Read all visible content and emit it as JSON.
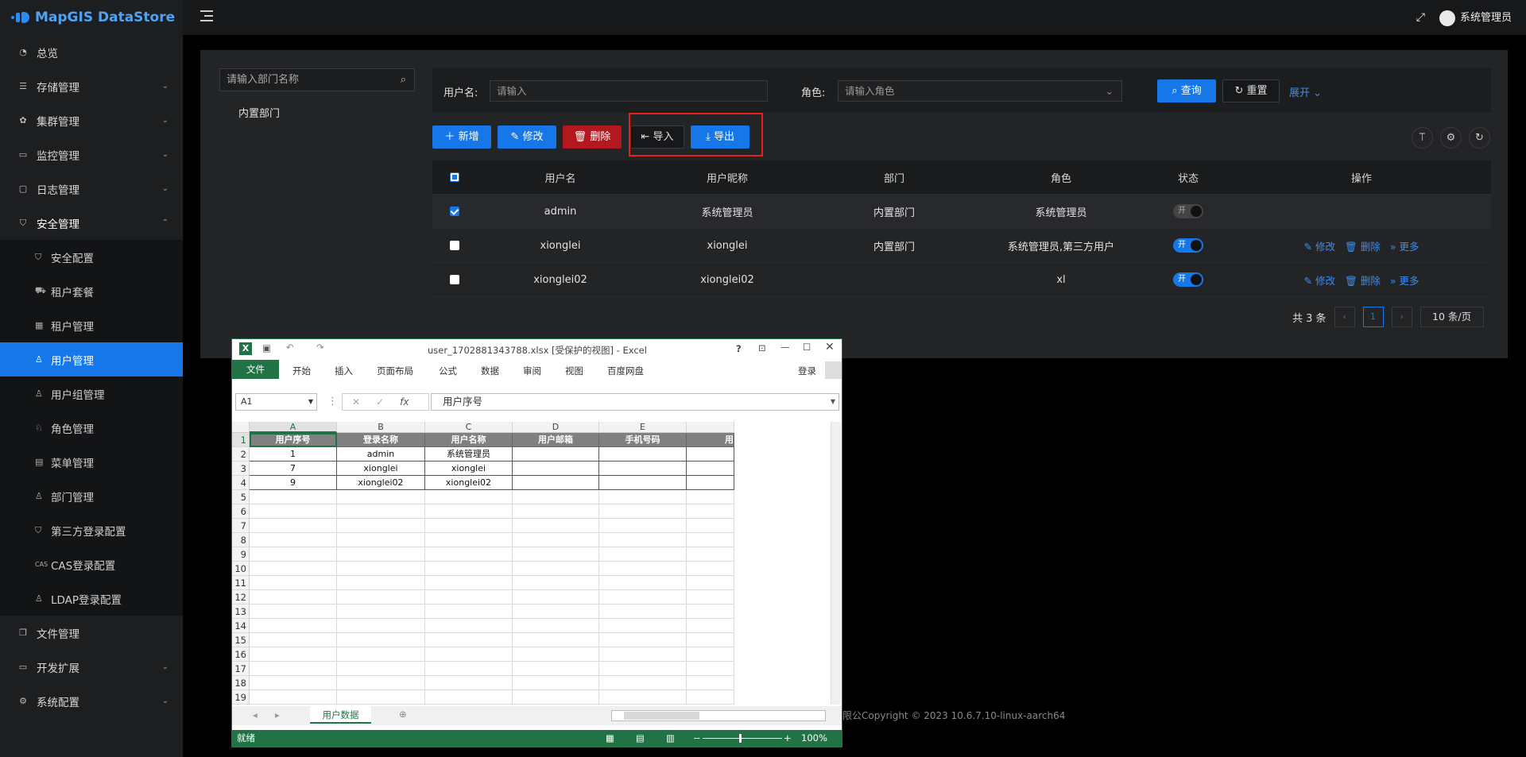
{
  "app": {
    "logo_text": "MapGIS DataStore",
    "user_name": "系统管理员"
  },
  "sidebar": {
    "items": [
      {
        "label": "总览",
        "icon": "dashboard-icon"
      },
      {
        "label": "存储管理",
        "icon": "storage-icon"
      },
      {
        "label": "集群管理",
        "icon": "cluster-icon"
      },
      {
        "label": "监控管理",
        "icon": "monitor-icon"
      },
      {
        "label": "日志管理",
        "icon": "log-icon"
      },
      {
        "label": "安全管理",
        "icon": "shield-icon"
      }
    ],
    "security_sub": [
      {
        "label": "安全配置"
      },
      {
        "label": "租户套餐"
      },
      {
        "label": "租户管理"
      },
      {
        "label": "用户管理"
      },
      {
        "label": "用户组管理"
      },
      {
        "label": "角色管理"
      },
      {
        "label": "菜单管理"
      },
      {
        "label": "部门管理"
      },
      {
        "label": "第三方登录配置"
      },
      {
        "label": "CAS登录配置"
      },
      {
        "label": "LDAP登录配置"
      }
    ],
    "bottom_items": [
      {
        "label": "文件管理"
      },
      {
        "label": "开发扩展"
      },
      {
        "label": "系统配置"
      }
    ]
  },
  "dept": {
    "search_placeholder": "请输入部门名称",
    "node": "内置部门"
  },
  "filter": {
    "username_label": "用户名:",
    "username_placeholder": "请输入",
    "role_label": "角色:",
    "role_placeholder": "请输入角色",
    "query": "查询",
    "reset": "重置",
    "expand": "展开"
  },
  "toolbar": {
    "add": "新增",
    "edit": "修改",
    "delete": "删除",
    "import": "导入",
    "export": "导出"
  },
  "table": {
    "headers": [
      "用户名",
      "用户昵称",
      "部门",
      "角色",
      "状态",
      "操作"
    ],
    "rows": [
      {
        "username": "admin",
        "nickname": "系统管理员",
        "dept": "内置部门",
        "role": "系统管理员",
        "status": "开",
        "checked": true
      },
      {
        "username": "xionglei",
        "nickname": "xionglei",
        "dept": "内置部门",
        "role": "系统管理员,第三方用户",
        "status": "开",
        "checked": false
      },
      {
        "username": "xionglei02",
        "nickname": "xionglei02",
        "dept": "",
        "role": "xl",
        "status": "开",
        "checked": false
      }
    ],
    "ops": {
      "edit": "修改",
      "delete": "删除",
      "more": "更多"
    }
  },
  "pager": {
    "total": "共 3 条",
    "page": "1",
    "size": "10 条/页"
  },
  "footer": "限公Copyright © 2023 10.6.7.10-linux-aarch64",
  "excel": {
    "title": "user_1702881343788.xlsx  [受保护的视图] - Excel",
    "help": "?",
    "tabs": [
      "文件",
      "开始",
      "插入",
      "页面布局",
      "公式",
      "数据",
      "审阅",
      "视图",
      "百度网盘"
    ],
    "login": "登录",
    "namebox": "A1",
    "formula": "用户序号",
    "columns": [
      "A",
      "B",
      "C",
      "D",
      "E"
    ],
    "header_row": [
      "用户序号",
      "登录名称",
      "用户名称",
      "用户邮箱",
      "手机号码",
      "用"
    ],
    "data_rows": [
      [
        "1",
        "admin",
        "系统管理员",
        "",
        ""
      ],
      [
        "7",
        "xionglei",
        "xionglei",
        "",
        ""
      ],
      [
        "9",
        "xionglei02",
        "xionglei02",
        "",
        ""
      ]
    ],
    "row_numbers": [
      "1",
      "2",
      "3",
      "4",
      "5",
      "6",
      "7",
      "8",
      "9",
      "10",
      "11",
      "12",
      "13",
      "14",
      "15",
      "16",
      "17",
      "18",
      "19"
    ],
    "sheet": "用户数据",
    "status": "就绪",
    "zoom": "100%"
  }
}
